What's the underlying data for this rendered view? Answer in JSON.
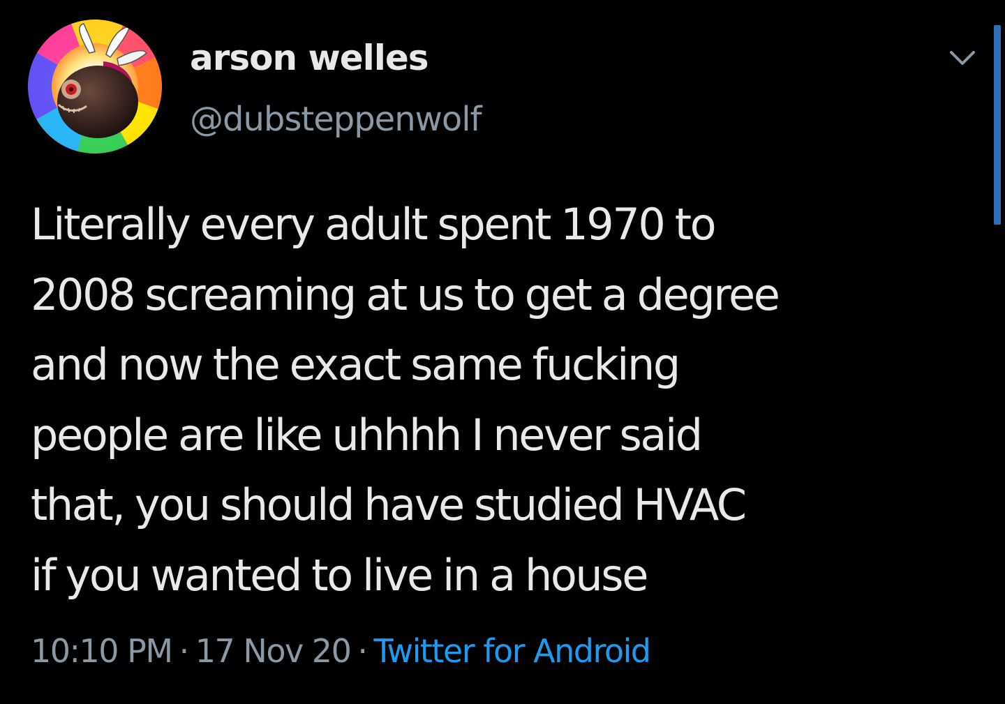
{
  "tweet": {
    "author": {
      "display_name": "arson welles",
      "handle": "@dubsteppenwolf",
      "avatar_icon": "winged-round-creature-avatar"
    },
    "menu_icon": "chevron-down-icon",
    "text_lines": [
      "Literally every adult spent 1970 to",
      "2008 screaming at us to get a degree",
      "and now the exact same fucking",
      "people are like uhhhh I never said",
      "that, you should have studied HVAC",
      "if you wanted to live in a house"
    ],
    "time": "10:10 PM",
    "separator": "·",
    "date": "17 Nov 20",
    "source": "Twitter for Android"
  },
  "colors": {
    "background": "#000000",
    "primary_text": "#e7e9ea",
    "secondary_text": "#8b98a5",
    "link": "#1d9bf0",
    "scrollbar": "#2f6fb8"
  }
}
